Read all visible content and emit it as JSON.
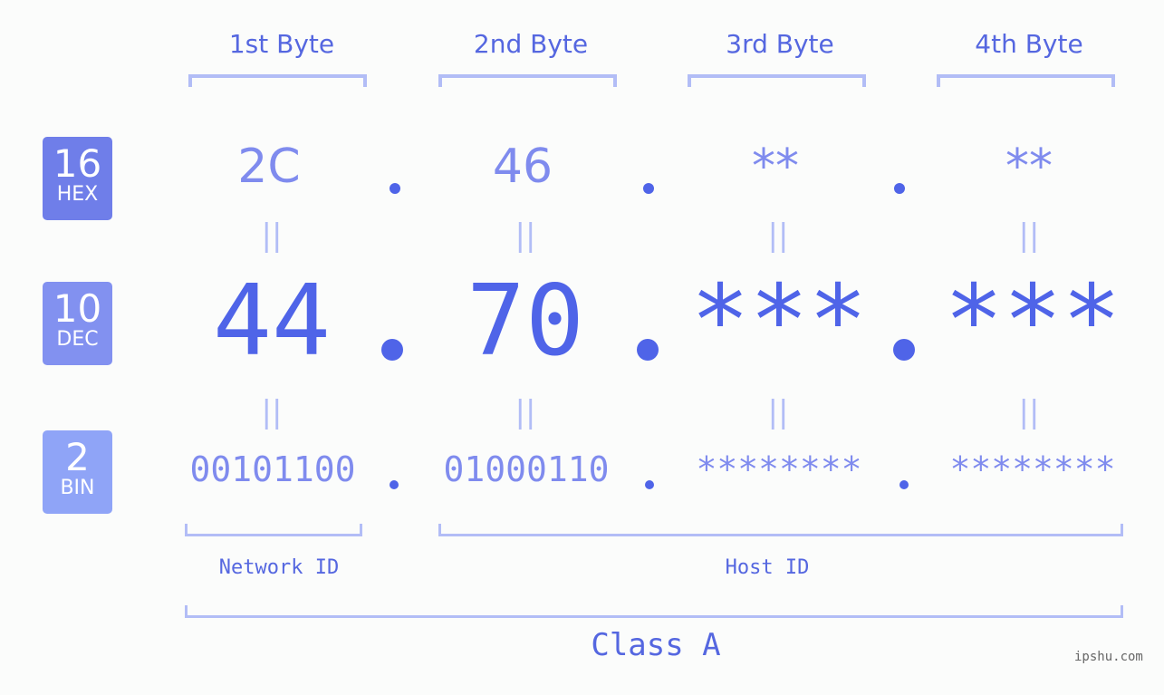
{
  "bytes": [
    {
      "label": "1st Byte",
      "hex": "2C",
      "dec": "44",
      "bin": "00101100"
    },
    {
      "label": "2nd Byte",
      "hex": "46",
      "dec": "70",
      "bin": "01000110"
    },
    {
      "label": "3rd Byte",
      "hex": "**",
      "dec": "***",
      "bin": "********"
    },
    {
      "label": "4th Byte",
      "hex": "**",
      "dec": "***",
      "bin": "********"
    }
  ],
  "badges": {
    "hex": {
      "num": "16",
      "unit": "HEX",
      "color": "#6f7ee9"
    },
    "dec": {
      "num": "10",
      "unit": "DEC",
      "color": "#8291f0"
    },
    "bin": {
      "num": "2",
      "unit": "BIN",
      "color": "#8fa4f7"
    }
  },
  "equals_symbol": "||",
  "labels": {
    "network": "Network ID",
    "host": "Host ID",
    "class": "Class A"
  },
  "watermark": "ipshu.com",
  "colors": {
    "primary": "#4f64e8",
    "secondary": "#7f8bee",
    "bracket": "#b2bdf6"
  }
}
